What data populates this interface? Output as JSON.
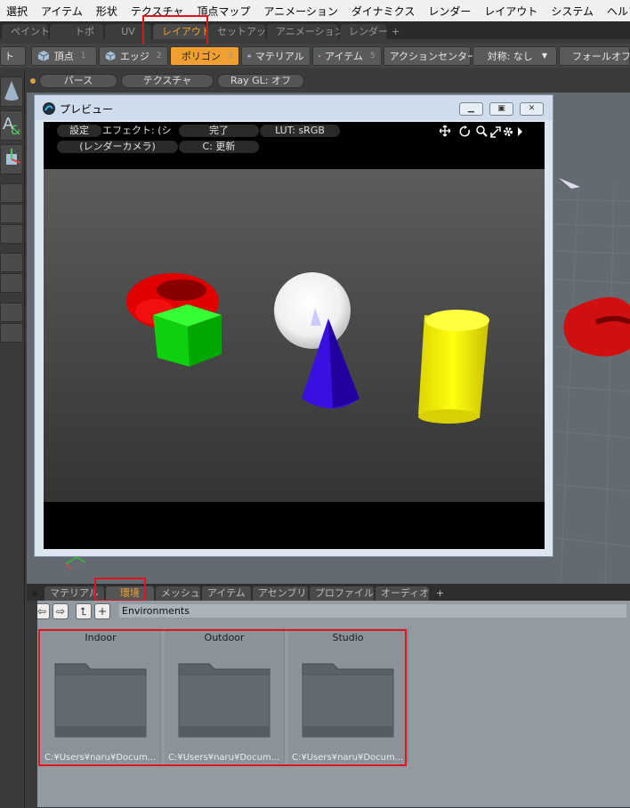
{
  "menubar": [
    "選択",
    "アイテム",
    "形状",
    "テクスチャ",
    "頂点マップ",
    "アニメーション",
    "ダイナミクス",
    "レンダー",
    "レイアウト",
    "システム",
    "ヘルプ"
  ],
  "layout_tabs": [
    "ペイント",
    "トポ",
    "UV",
    "レイアウト",
    "セットアップ",
    "アニメーション",
    "レンダー",
    "+"
  ],
  "active_layout_tab": "レイアウト",
  "toolbar": {
    "left_cut": "ト",
    "modes": [
      {
        "label": "頂点",
        "num": "1"
      },
      {
        "label": "エッジ",
        "num": "2"
      },
      {
        "label": "ポリゴン",
        "num": "3"
      },
      {
        "label": "マテリアル",
        "num": "4"
      },
      {
        "label": "アイテム",
        "num": "5"
      }
    ],
    "action_center": "アクションセンター",
    "symmetry": "対称: なし",
    "falloff": "フォールオフ"
  },
  "subbar": [
    "パース",
    "テクスチャ",
    "Ray GL: オフ"
  ],
  "preview": {
    "title": "プレビュー",
    "buttons": {
      "settings": "設定",
      "effect": "エフェクト: (シェ...",
      "done": "完了",
      "lut": "LUT: sRGB",
      "camera": "(レンダーカメラ)",
      "update": "C: 更新"
    }
  },
  "bottom_tabs": [
    "マテリアル",
    "環境",
    "メッシュ",
    "アイテム",
    "アセンブリ",
    "プロファイル",
    "オーディオ",
    "+"
  ],
  "active_bottom_tab": "環境",
  "browser": {
    "path": "Environments",
    "folders": [
      {
        "name": "Indoor",
        "path": "C:¥Users¥naru¥Docum..."
      },
      {
        "name": "Outdoor",
        "path": "C:¥Users¥naru¥Docum..."
      },
      {
        "name": "Studio",
        "path": "C:¥Users¥naru¥Docum..."
      }
    ]
  },
  "colors": {
    "accent": "#f0a030",
    "highlight": "#e0141e"
  }
}
